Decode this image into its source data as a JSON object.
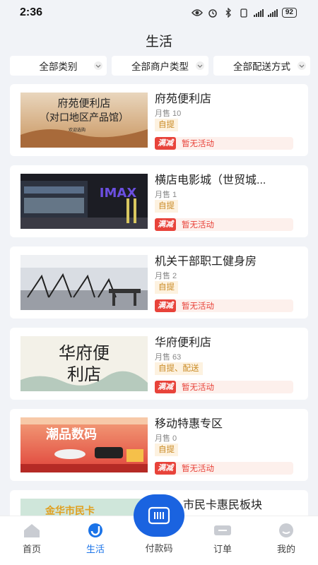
{
  "status": {
    "time": "2:36",
    "battery": "92"
  },
  "header": {
    "title": "生活"
  },
  "filters": [
    {
      "label": "全部类别"
    },
    {
      "label": "全部商户类型"
    },
    {
      "label": "全部配送方式"
    }
  ],
  "stores": [
    {
      "name": "府苑便利店",
      "sales": "月售 10",
      "delivery": "自提",
      "promo_tag": "满减",
      "promo_text": "暂无活动",
      "image_text": [
        "府苑便利店",
        "（对口地区产品馆）",
        "欢迎选购"
      ]
    },
    {
      "name": "横店电影城（世贸城...",
      "sales": "月售 1",
      "delivery": "自提",
      "promo_tag": "满减",
      "promo_text": "暂无活动",
      "image_text": [
        "IMAX"
      ]
    },
    {
      "name": "机关干部职工健身房",
      "sales": "月售 2",
      "delivery": "自提",
      "promo_tag": "满减",
      "promo_text": "暂无活动"
    },
    {
      "name": "华府便利店",
      "sales": "月售 63",
      "delivery": "自提、配送",
      "promo_tag": "满减",
      "promo_text": "暂无活动",
      "image_text": [
        "华府便",
        "利店"
      ]
    },
    {
      "name": "移动特惠专区",
      "sales": "月售 0",
      "delivery": "自提",
      "promo_tag": "满减",
      "promo_text": "暂无活动",
      "image_text": [
        "潮品数码"
      ]
    },
    {
      "name": "市民卡惠民板块",
      "image_text": [
        "金华市民卡"
      ]
    }
  ],
  "tabbar": {
    "items": [
      {
        "label": "首页"
      },
      {
        "label": "生活"
      },
      {
        "label": "付款码"
      },
      {
        "label": "订单"
      },
      {
        "label": "我的"
      }
    ]
  },
  "colors": {
    "accent": "#1a73e8",
    "promo": "#e8433a",
    "delivery_bg": "#fdf2e0"
  }
}
